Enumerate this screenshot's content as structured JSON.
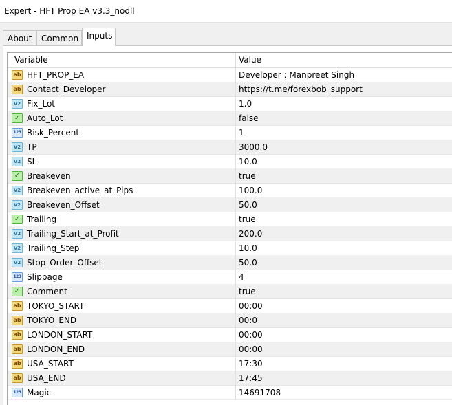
{
  "window": {
    "title": "Expert - HFT Prop EA v3.3_nodll"
  },
  "tabs": [
    {
      "label": "About"
    },
    {
      "label": "Common"
    },
    {
      "label": "Inputs"
    }
  ],
  "active_tab": "Inputs",
  "grid": {
    "headers": {
      "variable": "Variable",
      "value": "Value"
    },
    "rows": [
      {
        "type": "string",
        "icon": "ab-icon",
        "name": "HFT_PROP_EA",
        "value": "Developer : Manpreet Singh"
      },
      {
        "type": "string",
        "icon": "ab-icon",
        "name": "Contact_Developer",
        "value": "https://t.me/forexbob_support"
      },
      {
        "type": "double",
        "icon": "v2-icon",
        "name": "Fix_Lot",
        "value": "1.0"
      },
      {
        "type": "bool",
        "icon": "bool-icon",
        "name": "Auto_Lot",
        "value": "false"
      },
      {
        "type": "int",
        "icon": "123-icon",
        "name": "Risk_Percent",
        "value": "1"
      },
      {
        "type": "double",
        "icon": "v2-icon",
        "name": "TP",
        "value": "3000.0"
      },
      {
        "type": "double",
        "icon": "v2-icon",
        "name": "SL",
        "value": "10.0"
      },
      {
        "type": "bool",
        "icon": "bool-icon",
        "name": "Breakeven",
        "value": "true"
      },
      {
        "type": "double",
        "icon": "v2-icon",
        "name": "Breakeven_active_at_Pips",
        "value": "100.0"
      },
      {
        "type": "double",
        "icon": "v2-icon",
        "name": "Breakeven_Offset",
        "value": "50.0"
      },
      {
        "type": "bool",
        "icon": "bool-icon",
        "name": "Trailing",
        "value": "true"
      },
      {
        "type": "double",
        "icon": "v2-icon",
        "name": "Trailing_Start_at_Profit",
        "value": "200.0"
      },
      {
        "type": "double",
        "icon": "v2-icon",
        "name": "Trailing_Step",
        "value": "10.0"
      },
      {
        "type": "double",
        "icon": "v2-icon",
        "name": "Stop_Order_Offset",
        "value": "50.0"
      },
      {
        "type": "int",
        "icon": "123-icon",
        "name": "Slippage",
        "value": "4"
      },
      {
        "type": "bool",
        "icon": "bool-icon",
        "name": "Comment",
        "value": "true"
      },
      {
        "type": "string",
        "icon": "ab-icon",
        "name": "TOKYO_START",
        "value": "00:00"
      },
      {
        "type": "string",
        "icon": "ab-icon",
        "name": "TOKYO_END",
        "value": "00:0"
      },
      {
        "type": "string",
        "icon": "ab-icon",
        "name": "LONDON_START",
        "value": "00:00"
      },
      {
        "type": "string",
        "icon": "ab-icon",
        "name": "LONDON_END",
        "value": "00:00"
      },
      {
        "type": "string",
        "icon": "ab-icon",
        "name": "USA_START",
        "value": "17:30"
      },
      {
        "type": "string",
        "icon": "ab-icon",
        "name": "USA_END",
        "value": "17:45"
      },
      {
        "type": "int",
        "icon": "123-icon",
        "name": "Magic",
        "value": "14691708"
      }
    ]
  },
  "icon_glyphs": {
    "string": "ab",
    "double": "V2",
    "bool": "✓",
    "int": "123"
  },
  "colors": {
    "alt_row": "#f0f0f0",
    "tab_active_bg": "#ffffff",
    "window_bg": "#f0f0f0"
  }
}
